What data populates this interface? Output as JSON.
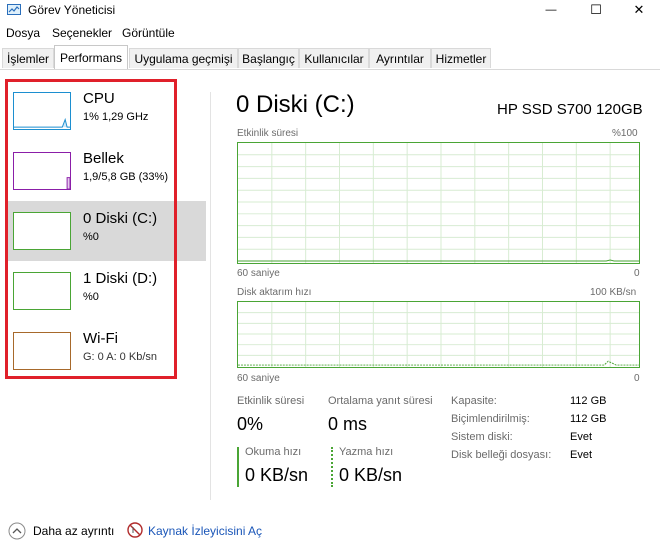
{
  "window": {
    "title": "Görev Yöneticisi",
    "minimize_glyph": "—",
    "maximize_glyph": "☐",
    "close_glyph": "✕"
  },
  "menu": [
    "Dosya",
    "Seçenekler",
    "Görüntüle"
  ],
  "tabs": [
    {
      "label": "İşlemler",
      "active": false
    },
    {
      "label": "Performans",
      "active": true
    },
    {
      "label": "Uygulama geçmişi",
      "active": false
    },
    {
      "label": "Başlangıç",
      "active": false
    },
    {
      "label": "Kullanıcılar",
      "active": false
    },
    {
      "label": "Ayrıntılar",
      "active": false
    },
    {
      "label": "Hizmetler",
      "active": false
    }
  ],
  "sidebar": {
    "items": [
      {
        "label": "CPU",
        "sub": "1% 1,29 GHz",
        "color": "#1c8fd0"
      },
      {
        "label": "Bellek",
        "sub": "1,9/5,8 GB (33%)",
        "color": "#8b1ea8"
      },
      {
        "label": "0 Diski (C:)",
        "sub": "%0",
        "color": "#4aa535",
        "selected": true
      },
      {
        "label": "1 Diski (D:)",
        "sub": "%0",
        "color": "#4aa535"
      },
      {
        "label": "Wi-Fi",
        "sub": "G: 0 A: 0 Kb/sn",
        "color": "#a7692b"
      }
    ]
  },
  "main": {
    "title": "0 Diski (C:)",
    "model": "HP SSD S700 120GB",
    "chart1": {
      "label": "Etkinlik süresi",
      "max_label": "%100",
      "x_left": "60 saniye",
      "x_right": "0"
    },
    "chart2": {
      "label": "Disk aktarım hızı",
      "max_label": "100 KB/sn",
      "x_left": "60 saniye",
      "x_right": "0"
    },
    "stats": {
      "active_time_label": "Etkinlik süresi",
      "active_time_value": "0%",
      "response_label": "Ortalama yanıt süresi",
      "response_value": "0 ms",
      "read_label": "Okuma hızı",
      "read_value": "0 KB/sn",
      "write_label": "Yazma hızı",
      "write_value": "0 KB/sn"
    },
    "info": [
      {
        "label": "Kapasite:",
        "value": "112 GB"
      },
      {
        "label": "Biçimlendirilmiş:",
        "value": "112 GB"
      },
      {
        "label": "Sistem diski:",
        "value": "Evet"
      },
      {
        "label": "Disk belleği dosyası:",
        "value": "Evet"
      }
    ]
  },
  "footer": {
    "less_details": "Daha az ayrıntı",
    "resource_monitor": "Kaynak İzleyicisini Aç"
  },
  "colors": {
    "disk_green": "#4aa535",
    "highlight_red": "#e0202a",
    "link_blue": "#1a56b8"
  }
}
